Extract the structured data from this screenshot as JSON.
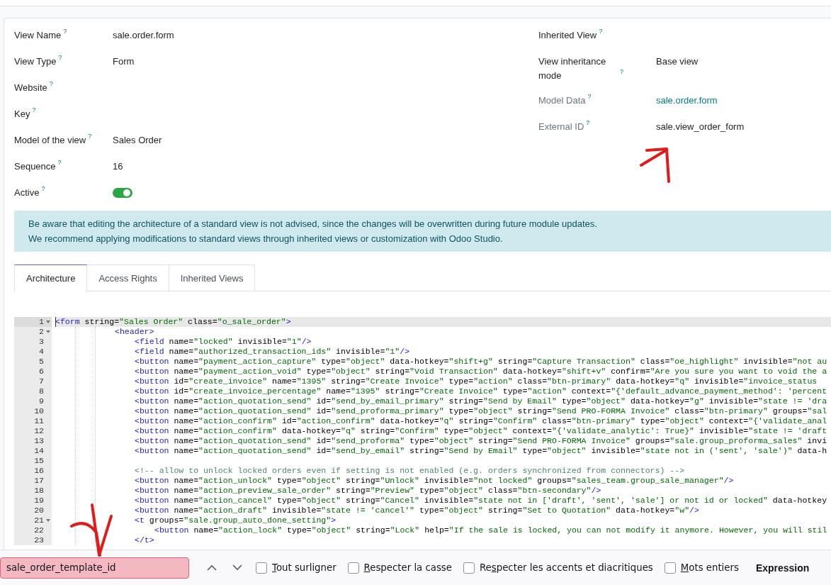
{
  "form_left": [
    {
      "label": "View Name",
      "help": "?",
      "kind": "text",
      "value": "sale.order.form",
      "readonly": false
    },
    {
      "label": "View Type",
      "help": "?",
      "kind": "text",
      "value": "Form",
      "readonly": false
    },
    {
      "label": "Website",
      "help": "?",
      "kind": "text",
      "readonly": false
    },
    {
      "label": "Key",
      "help": "?",
      "kind": "text",
      "readonly": false
    },
    {
      "label": "Model of the view",
      "help": "?",
      "kind": "text",
      "value": "Sales Order",
      "readonly": false
    },
    {
      "label": "Sequence",
      "help": "?",
      "kind": "text",
      "value": "16",
      "readonly": false
    },
    {
      "label": "Active",
      "help": "?",
      "kind": "toggle",
      "on": true,
      "readonly": false
    }
  ],
  "form_right": [
    {
      "label": "Inherited View",
      "help": "?",
      "kind": "text",
      "readonly": false
    },
    {
      "label": "View inheritance mode",
      "help": "?",
      "kind": "text",
      "value": "Base view",
      "readonly": false
    },
    {
      "label": "Model Data",
      "help": "?",
      "kind": "link",
      "value": "sale.order.form",
      "readonly": true
    },
    {
      "label": "External ID",
      "help": "?",
      "kind": "text",
      "value": "sale.view_order_form",
      "readonly": true
    }
  ],
  "alert": {
    "lines": [
      "Be aware that editing the architecture of a standard view is not advised, since the changes will be overwritten during future module updates.",
      "We recommend applying modifications to standard views through inherited views or customization with Odoo Studio."
    ]
  },
  "tabs": [
    {
      "label": "Architecture",
      "selected": true
    },
    {
      "label": "Access Rights",
      "selected": false
    },
    {
      "label": "Inherited Views",
      "selected": false
    }
  ],
  "code_editor": {
    "lines": [
      {
        "number": "1",
        "text": "<form string=\"Sales Order\" class=\"o_sale_order\">",
        "foldable": true,
        "active": true,
        "children": [
          {
            "number": "2",
            "text": "<header>",
            "foldable": true,
            "active": false,
            "children": [
              {
                "number": "3",
                "text": "<field name=\"locked\" invisible=\"1\"/>",
                "foldable": false,
                "active": false
              },
              {
                "number": "4",
                "text": "<field name=\"authorized_transaction_ids\" invisible=\"1\"/>",
                "foldable": false,
                "active": false
              },
              {
                "number": "5",
                "text": "<button name=\"payment_action_capture\" type=\"object\" data-hotkey=\"shift+g\" string=\"Capture Transaction\" class=\"oe_highlight\" invisible=\"not au",
                "foldable": false,
                "active": false
              },
              {
                "number": "6",
                "text": "<button name=\"payment_action_void\" type=\"object\" string=\"Void Transaction\" data-hotkey=\"shift+v\" confirm=\"Are you sure you want to void the a",
                "foldable": false,
                "active": false
              },
              {
                "number": "7",
                "text": "<button id=\"create_invoice\" name=\"1395\" string=\"Create Invoice\" type=\"action\" class=\"btn-primary\" data-hotkey=\"q\" invisible=\"invoice_status",
                "foldable": false,
                "active": false
              },
              {
                "number": "8",
                "text": "<button id=\"create_invoice_percentage\" name=\"1395\" string=\"Create Invoice\" type=\"action\" context=\"{'default_advance_payment_method': 'percent",
                "foldable": false,
                "active": false
              },
              {
                "number": "9",
                "text": "<button name=\"action_quotation_send\" id=\"send_by_email_primary\" string=\"Send by Email\" type=\"object\" data-hotkey=\"g\" invisible=\"state != 'dra",
                "foldable": false,
                "active": false
              },
              {
                "number": "10",
                "text": "<button name=\"action_quotation_send\" id=\"send_proforma_primary\" type=\"object\" string=\"Send PRO-FORMA Invoice\" class=\"btn-primary\" groups=\"sal",
                "foldable": false,
                "active": false
              },
              {
                "number": "11",
                "text": "<button name=\"action_confirm\" id=\"action_confirm\" data-hotkey=\"q\" string=\"Confirm\" class=\"btn-primary\" type=\"object\" context=\"{'validate_anal",
                "foldable": false,
                "active": false
              },
              {
                "number": "12",
                "text": "<button name=\"action_confirm\" data-hotkey=\"q\" string=\"Confirm\" type=\"object\" context=\"{'validate_analytic': True}\" invisible=\"state != 'draft",
                "foldable": false,
                "active": false
              },
              {
                "number": "13",
                "text": "<button name=\"action_quotation_send\" id=\"send_proforma\" type=\"object\" string=\"Send PRO-FORMA Invoice\" groups=\"sale.group_proforma_sales\" invi",
                "foldable": false,
                "active": false
              },
              {
                "number": "14",
                "text": "<button name=\"action_quotation_send\" id=\"send_by_email\" string=\"Send by Email\" type=\"object\" invisible=\"state not in ('sent', 'sale')\" data-h",
                "foldable": false,
                "active": false
              },
              {
                "number": "15",
                "foldable": false,
                "active": false
              },
              {
                "number": "16",
                "text": "<!-- allow to unlock locked orders even if setting is not enabled (e.g. orders synchronized from connectors) -->",
                "foldable": false,
                "active": false
              },
              {
                "number": "17",
                "text": "<button name=\"action_unlock\" type=\"object\" string=\"Unlock\" invisible=\"not locked\" groups=\"sales_team.group_sale_manager\"/>",
                "foldable": false,
                "active": false
              },
              {
                "number": "18",
                "text": "<button name=\"action_preview_sale_order\" string=\"Preview\" type=\"object\" class=\"btn-secondary\"/>",
                "foldable": false,
                "active": false
              },
              {
                "number": "19",
                "text": "<button name=\"action_cancel\" type=\"object\" string=\"Cancel\" invisible=\"state not in ['draft', 'sent', 'sale'] or not id or locked\" data-hotkey",
                "foldable": false,
                "active": false
              },
              {
                "number": "20",
                "text": "<button name=\"action_draft\" invisible=\"state != 'cancel'\" type=\"object\" string=\"Set to Quotation\" data-hotkey=\"w\"/>",
                "foldable": false,
                "active": false
              },
              {
                "number": "21",
                "text": "<t groups=\"sale.group_auto_done_setting\">",
                "foldable": true,
                "active": false,
                "children": [
                  {
                    "number": "22",
                    "text": "<button name=\"action_lock\" type=\"object\" string=\"Lock\" help=\"If the sale is locked, you can not modify it anymore. However, you will stil",
                    "foldable": false,
                    "active": false
                  }
                ]
              },
              {
                "number": "23",
                "text": "</t>",
                "foldable": false,
                "active": false
              }
            ]
          }
        ]
      }
    ]
  },
  "find_bar": {
    "query": "sale_order_template_id",
    "not_found": true,
    "options": [
      {
        "key": "T",
        "rest": "out surligner",
        "checked": false
      },
      {
        "key": "R",
        "rest": "especter la casse",
        "checked": false
      },
      {
        "prefix": "Re",
        "key": "s",
        "rest": "pecter les accents et diacritiques",
        "checked": false
      },
      {
        "key": "M",
        "rest": "ots entiers",
        "checked": false
      }
    ],
    "status": "Expression"
  }
}
